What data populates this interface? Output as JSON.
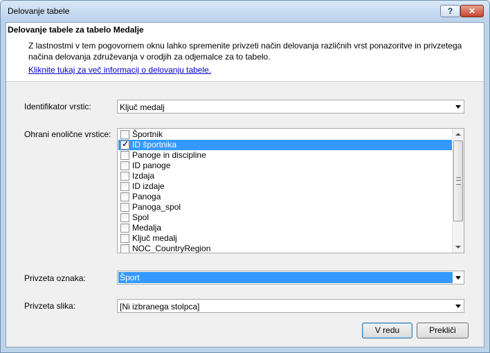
{
  "window": {
    "title": "Delovanje tabele",
    "help_label": "?",
    "close_label": "✕"
  },
  "header": {
    "title": "Delovanje tabele za tabelo Medalje",
    "description": "Z lastnostmi v tem pogovornem oknu lahko spremenite privzeti način delovanja različnih vrst ponazoritve in privzetega načina delovanja združevanja v orodjih za odjemalce za to tabelo.",
    "link": "Kliknite tukaj za več informacij o delovanju tabele."
  },
  "row_identifier": {
    "label": "Identifikator vrstic:",
    "value": "Ključ medalj"
  },
  "keep_unique": {
    "label": "Ohrani enolične vrstice:",
    "items": [
      {
        "label": "Športnik",
        "checked": false,
        "selected": false
      },
      {
        "label": "ID športnika",
        "checked": true,
        "selected": true
      },
      {
        "label": "Panoge in discipline",
        "checked": false,
        "selected": false
      },
      {
        "label": "ID panoge",
        "checked": false,
        "selected": false
      },
      {
        "label": "Izdaja",
        "checked": false,
        "selected": false
      },
      {
        "label": "ID izdaje",
        "checked": false,
        "selected": false
      },
      {
        "label": "Panoga",
        "checked": false,
        "selected": false
      },
      {
        "label": "Panoga_spol",
        "checked": false,
        "selected": false
      },
      {
        "label": "Spol",
        "checked": false,
        "selected": false
      },
      {
        "label": "Medalja",
        "checked": false,
        "selected": false
      },
      {
        "label": "Ključ medalj",
        "checked": false,
        "selected": false
      },
      {
        "label": "NOC_CountryRegion",
        "checked": false,
        "selected": false
      }
    ]
  },
  "default_label": {
    "label": "Privzeta oznaka:",
    "value": "Šport"
  },
  "default_image": {
    "label": "Privzeta slika:",
    "value": "[Ni izbranega stolpca]"
  },
  "buttons": {
    "ok": "V redu",
    "cancel": "Prekliči"
  },
  "colors": {
    "selection": "#3399ff",
    "link": "#0000cc"
  }
}
